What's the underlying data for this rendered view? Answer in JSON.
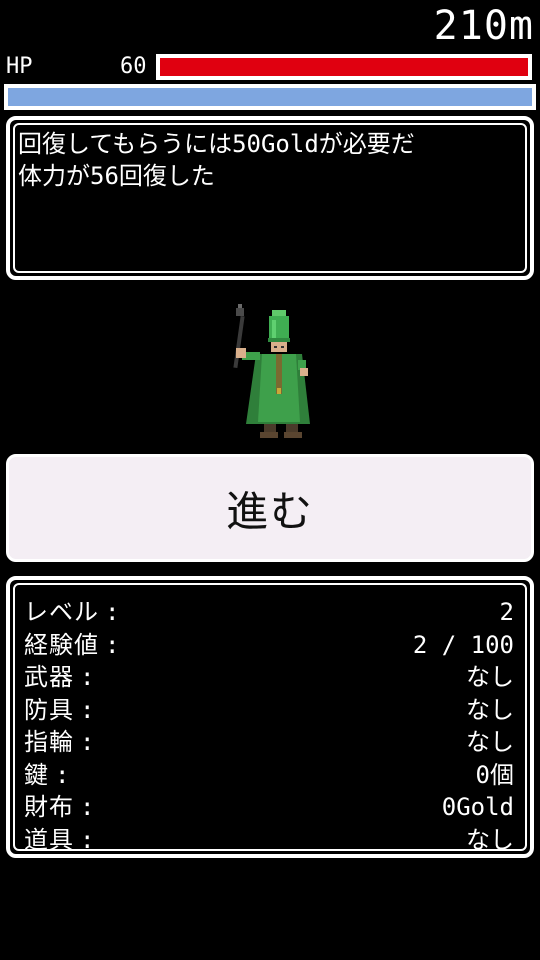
{
  "hud": {
    "distance": "210m",
    "hp_label": "HP",
    "hp_value": "60",
    "hp_fraction": 1.0,
    "mp_fraction": 1.0,
    "colors": {
      "hp": "#e00010",
      "mp": "#7ea6e0"
    }
  },
  "message": {
    "lines": [
      "回復してもらうには50Goldが必要だ",
      "体力が56回復した"
    ]
  },
  "npc": {
    "icon": "green-priest-sprite"
  },
  "action": {
    "proceed_label": "進む"
  },
  "status": {
    "separator": ":",
    "rows": [
      {
        "key": "レベル",
        "value": "2"
      },
      {
        "key": "経験値",
        "value": "2 / 100"
      },
      {
        "key": "武器",
        "value": "なし"
      },
      {
        "key": "防具",
        "value": "なし"
      },
      {
        "key": "指輪",
        "value": "なし"
      },
      {
        "key": "鍵",
        "value": "0個"
      },
      {
        "key": "財布",
        "value": "0Gold"
      },
      {
        "key": "道具",
        "value": "なし"
      }
    ]
  }
}
